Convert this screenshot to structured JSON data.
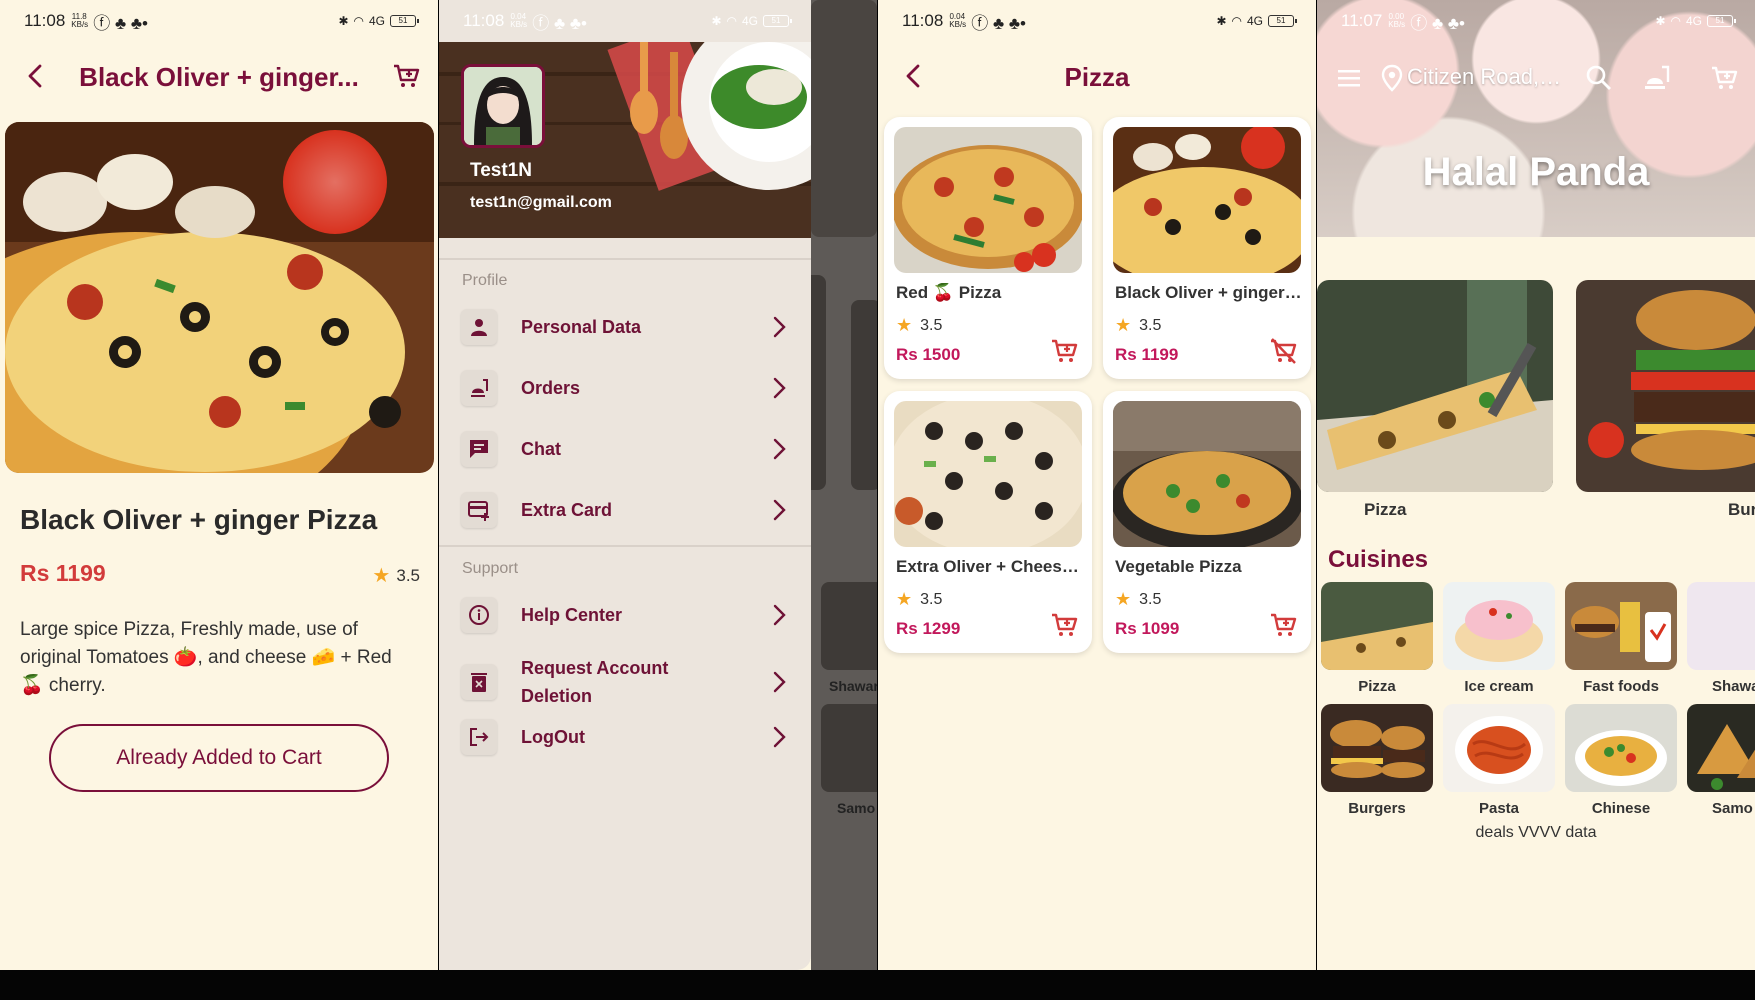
{
  "status": {
    "time_1": "11:08",
    "speed_1": "11.8 KB/s",
    "time_2": "11:08",
    "speed_2": "0.04 KB/s",
    "time_3": "11:08",
    "speed_3": "0.04 KB/s",
    "time_4": "11:07",
    "speed_4": "0.00 KB/s",
    "network": "4G",
    "battery": "51"
  },
  "detail": {
    "header_title": "Black Oliver + ginger...",
    "product_title": "Black Oliver + ginger Pizza",
    "price": "Rs 1199",
    "rating": "3.5",
    "description": "Large spice Pizza, Freshly made, use of original Tomatoes 🍅, and cheese 🧀 +  Red 🍒 cherry.",
    "button_label": "Already Added to Cart"
  },
  "drawer": {
    "user_name": "Test1N",
    "user_email": "test1n@gmail.com",
    "profile_section": "Profile",
    "support_section": "Support",
    "profile_items": [
      {
        "label": "Personal Data",
        "icon": "person-icon"
      },
      {
        "label": "Orders",
        "icon": "orders-icon"
      },
      {
        "label": "Chat",
        "icon": "chat-icon"
      },
      {
        "label": "Extra Card",
        "icon": "card-icon"
      }
    ],
    "support_items": [
      {
        "label": "Help Center",
        "icon": "info-icon"
      },
      {
        "label": "Request Account Deletion",
        "icon": "delete-icon"
      },
      {
        "label": "LogOut",
        "icon": "logout-icon"
      }
    ],
    "bg_labels": [
      "Shawar",
      "Samo"
    ]
  },
  "listing": {
    "title": "Pizza",
    "items": [
      {
        "name": "Red 🍒 Pizza",
        "rating": "3.5",
        "price": "Rs 1500",
        "in_cart": false
      },
      {
        "name": "Black Oliver + ginger Pizza",
        "rating": "3.5",
        "price": "Rs 1199",
        "in_cart": true
      },
      {
        "name": "Extra Oliver + Cheese Pizza",
        "rating": "3.5",
        "price": "Rs 1299",
        "in_cart": false
      },
      {
        "name": "Vegetable Pizza",
        "rating": "3.5",
        "price": "Rs 1099",
        "in_cart": false
      }
    ]
  },
  "home": {
    "location": "Citizen Road, S...",
    "banner_title": "Halal Panda",
    "featured": [
      "Pizza",
      "Burge"
    ],
    "cuisines_title": "Cuisines",
    "cuisines_row1": [
      "Pizza",
      "Ice cream",
      "Fast foods",
      "Shawar"
    ],
    "cuisines_row2": [
      "Burgers",
      "Pasta",
      "Chinese",
      "Samo"
    ],
    "deals_text": "deals VVVV data"
  },
  "colors": {
    "brand": "#7a0f3a",
    "price_red": "#d23b3b",
    "price_pink": "#c2185b",
    "background": "#fdf6e3",
    "star": "#f5a623"
  }
}
